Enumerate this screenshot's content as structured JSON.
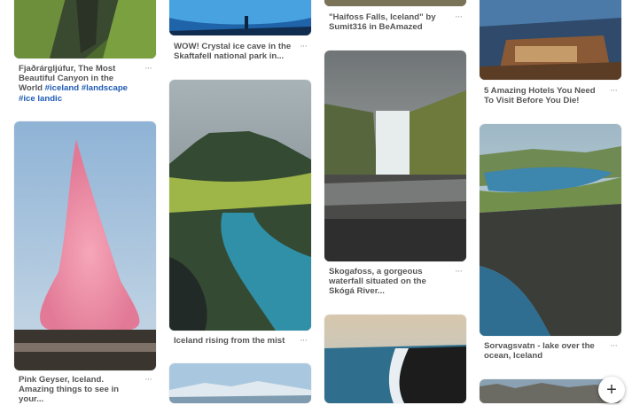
{
  "pins": [
    {
      "caption_parts": [
        "Fjaðrárgljúfur, The Most Beautiful Canyon in the World ",
        "#iceland",
        " ",
        "#landscape",
        " ",
        "#ice landic"
      ]
    },
    {
      "caption": "Pink Geyser, Iceland. Amazing things to see in your..."
    },
    {
      "caption": "WOW! Crystal ice cave in the Skaftafell national park in..."
    },
    {
      "caption": "Iceland rising from the mist"
    },
    {
      "caption": "\"Haifoss Falls, Iceland\" by Sumit316 in BeAmazed"
    },
    {
      "caption": "Skogafoss, a gorgeous waterfall situated on the Skógá River..."
    },
    {
      "caption": "5 Amazing Hotels You Need To Visit Before You Die!"
    },
    {
      "caption": "Sorvagsvatn - lake over the ocean, Iceland"
    }
  ],
  "icons": {
    "more": "more-dots-icon",
    "add": "plus-icon"
  },
  "fab_symbol": "+",
  "more_symbol": "···"
}
